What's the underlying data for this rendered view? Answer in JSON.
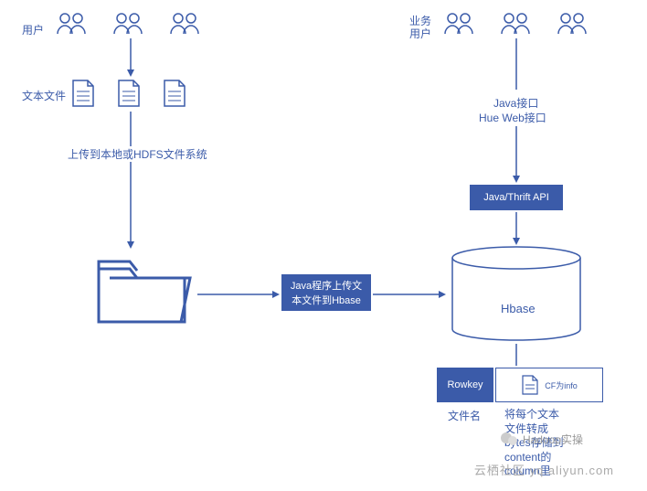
{
  "left": {
    "user_label": "用户",
    "file_label": "文本文件",
    "upload_text": "上传到本地或HDFS文件系统"
  },
  "right": {
    "user_label": "业务\n用户",
    "api_label_1": "Java接口",
    "api_label_2": "Hue Web接口",
    "api_box": "Java/Thrift API"
  },
  "center": {
    "upload_box": "Java程序上传文\n本文件到Hbase"
  },
  "hbase": {
    "label": "Hbase",
    "rowkey": "Rowkey",
    "filename": "文件名",
    "cf": "CF为info",
    "desc": "将每个文本\n文件转成\nbytes存储到\ncontent的\ncolumn里"
  },
  "watermark": {
    "brand": "Hadoop实操",
    "site": "云栖社区 yq.aliyun.com"
  }
}
